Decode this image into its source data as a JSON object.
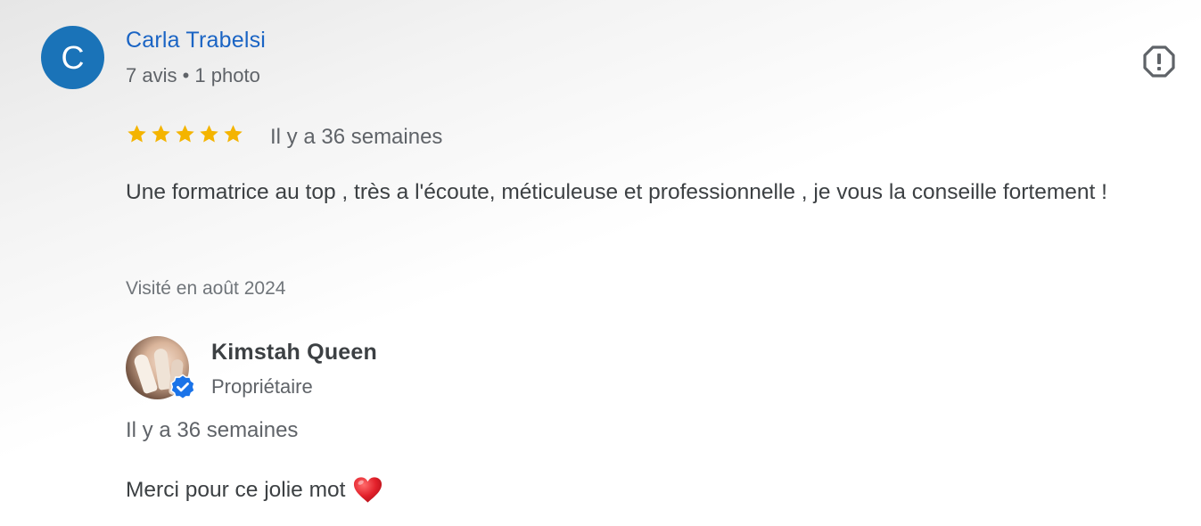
{
  "review": {
    "avatar_letter": "C",
    "reviewer_name": "Carla Trabelsi",
    "reviewer_meta": "7 avis • 1 photo",
    "rating": 5,
    "rating_max": 5,
    "date": "Il y a 36 semaines",
    "text": "Une formatrice au top , très a l'écoute, méticuleuse et professionnelle , je vous la conseille fortement !",
    "visited": "Visité en août 2024"
  },
  "reply": {
    "owner_name": "Kimstah Queen",
    "owner_role": "Propriétaire",
    "date": "Il y a 36 semaines",
    "text": "Merci pour ce jolie mot"
  },
  "icons": {
    "report": "report-flag-octagon-icon",
    "star": "star-icon",
    "verified": "verified-badge-icon",
    "heart": "red-heart-emoji-icon"
  },
  "colors": {
    "avatar_bg": "#1a73b8",
    "reviewer_name": "#1a64c4",
    "star": "#f4b400",
    "verified": "#1a73e8",
    "heart": "#e2202a"
  }
}
